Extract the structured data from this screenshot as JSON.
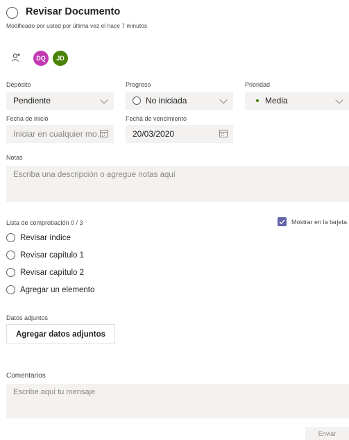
{
  "task": {
    "title": "Revisar Documento",
    "modified": "Modificado por usted por última vez el hace 7 minutos"
  },
  "assignees": [
    {
      "initials": "DQ",
      "color": "#c239b3"
    },
    {
      "initials": "JD",
      "color": "#498205"
    }
  ],
  "fields": {
    "bucket": {
      "label": "Depósito",
      "value": "Pendiente"
    },
    "progress": {
      "label": "Progreso",
      "value": "No iniciada"
    },
    "priority": {
      "label": "Prioridad",
      "value": "Media"
    },
    "start_date": {
      "label": "Fecha de inicio",
      "placeholder": "Iniciar en cualquier mo..."
    },
    "due_date": {
      "label": "Fecha de vencimiento",
      "value": "20/03/2020"
    }
  },
  "notes": {
    "label": "Notas",
    "placeholder": "Escriba una descripción o agregue notas aquí"
  },
  "checklist": {
    "label": "Lista de comprobación 0 / 3",
    "show_on_card": "Mostrar en la tarjeta",
    "show_on_card_checked": true,
    "items": [
      "Revisar índice",
      "Revisar capítulo 1",
      "Revisar capítulo 2"
    ],
    "add_item": "Agregar un elemento"
  },
  "attachments": {
    "label": "Datos adjuntos",
    "button": "Agregar datos adjuntos"
  },
  "comments": {
    "label": "Comentarios",
    "placeholder": "Escribe aquí tu mensaje",
    "send": "Enviar"
  },
  "colors": {
    "accent": "#6264a7",
    "field_bg": "#f3f2f1",
    "priority_dot": "#498205"
  }
}
